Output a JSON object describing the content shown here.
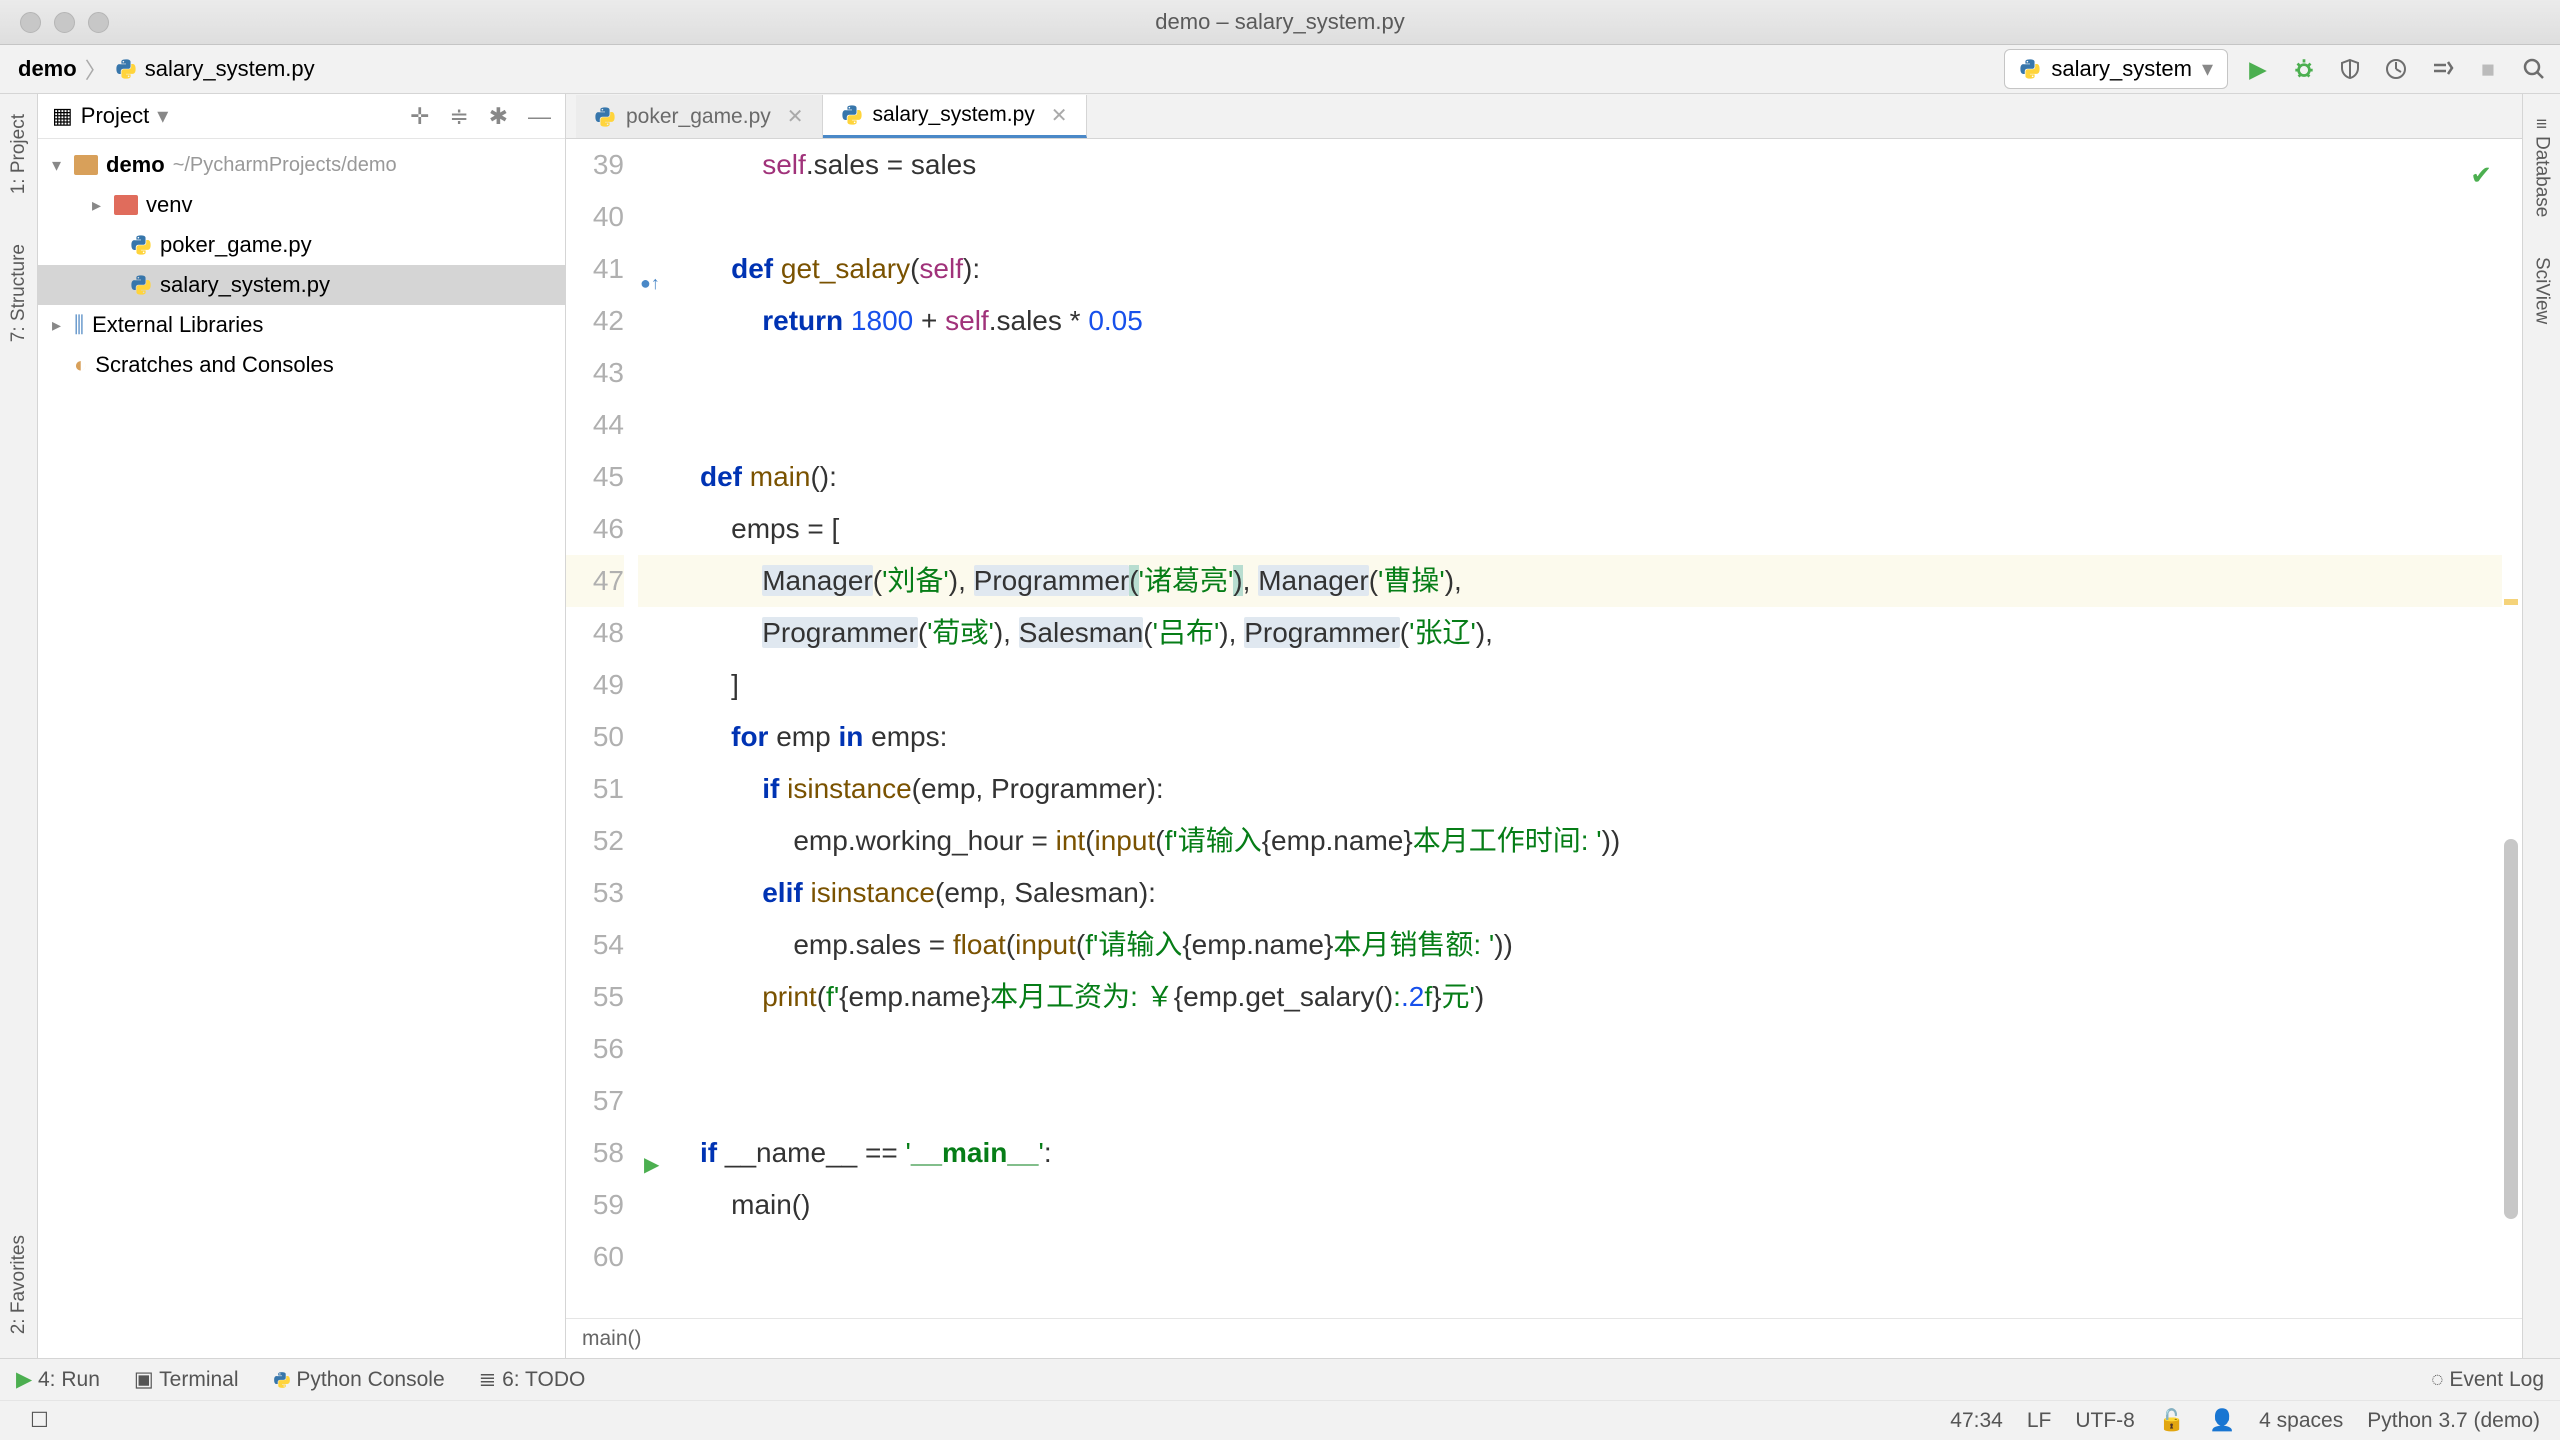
{
  "titlebar": {
    "title": "demo – salary_system.py"
  },
  "breadcrumb": {
    "root": "demo",
    "file": "salary_system.py"
  },
  "run_config": {
    "name": "salary_system"
  },
  "project_panel": {
    "title": "Project",
    "root": "demo",
    "root_path": "~/PycharmProjects/demo",
    "venv": "venv",
    "files": [
      "poker_game.py",
      "salary_system.py"
    ],
    "ext_lib": "External Libraries",
    "scratches": "Scratches and Consoles"
  },
  "leftrail": {
    "project": "1: Project",
    "structure": "7: Structure",
    "favorites": "2: Favorites"
  },
  "rightrail": {
    "database": "Database",
    "sciview": "SciView"
  },
  "tabs": [
    {
      "name": "poker_game.py",
      "active": false
    },
    {
      "name": "salary_system.py",
      "active": true
    }
  ],
  "code_lines": [
    {
      "n": 39,
      "html": "        <span class='self'>self</span>.sales = sales"
    },
    {
      "n": 40,
      "html": ""
    },
    {
      "n": 41,
      "html": "    <span class='kw'>def</span> <span class='func'>get_salary</span>(<span class='self'>self</span>):",
      "override": true
    },
    {
      "n": 42,
      "html": "        <span class='kw'>return</span> <span class='num'>1800</span> + <span class='self'>self</span>.sales * <span class='num'>0.05</span>"
    },
    {
      "n": 43,
      "html": ""
    },
    {
      "n": 44,
      "html": ""
    },
    {
      "n": 45,
      "html": "<span class='kw'>def</span> <span class='func'>main</span>():"
    },
    {
      "n": 46,
      "html": "    emps = ["
    },
    {
      "n": 47,
      "html": "        <span class='highlight'>Manager</span>(<span class='str'>'刘备'</span>), <span class='highlight'>Programmer</span><span class='paren-match'>(</span><span class='str'>'诸葛亮'</span><span class='paren-match'>)</span>, <span class='highlight'>Manager</span>(<span class='str'>'曹操'</span>),",
      "current": true
    },
    {
      "n": 48,
      "html": "        <span class='highlight'>Programmer</span>(<span class='str'>'荀彧'</span>), <span class='highlight'>Salesman</span>(<span class='str'>'吕布'</span>), <span class='highlight'>Programmer</span>(<span class='str'>'张辽'</span>),"
    },
    {
      "n": 49,
      "html": "    ]"
    },
    {
      "n": 50,
      "html": "    <span class='kw'>for</span> emp <span class='kw'>in</span> emps:"
    },
    {
      "n": 51,
      "html": "        <span class='kw'>if</span> <span class='bi'>isinstance</span>(emp, Programmer):"
    },
    {
      "n": 52,
      "html": "            emp.working_hour = <span class='bi'>int</span>(<span class='bi'>input</span>(<span class='green'>f</span><span class='str'>'请输入</span>{emp.name}<span class='str'>本月工作时间: '</span>))"
    },
    {
      "n": 53,
      "html": "        <span class='kw'>elif</span> <span class='bi'>isinstance</span>(emp, Salesman):"
    },
    {
      "n": 54,
      "html": "            emp.sales = <span class='bi'>float</span>(<span class='bi'>input</span>(<span class='green'>f</span><span class='str'>'请输入</span>{emp.name}<span class='str'>本月销售额: '</span>))"
    },
    {
      "n": 55,
      "html": "        <span class='bi'>print</span>(<span class='green'>f</span><span class='str'>'</span>{emp.name}<span class='str'>本月工资为: ￥</span>{emp.get_salary()<span class='str'>:</span><span class='num'>.2</span><span class='str'>f</span>}<span class='str'>元'</span>)"
    },
    {
      "n": 56,
      "html": ""
    },
    {
      "n": 57,
      "html": ""
    },
    {
      "n": 58,
      "html": "<span class='kw'>if</span> __name__ == <span class='str'>'</span><span class='str' style='font-weight:600'>__main__</span><span class='str'>'</span>:",
      "run": true
    },
    {
      "n": 59,
      "html": "    main()"
    },
    {
      "n": 60,
      "html": ""
    }
  ],
  "footer_crumb": "main()",
  "bottombar": {
    "run": "4: Run",
    "terminal": "Terminal",
    "pyconsole": "Python Console",
    "todo": "6: TODO",
    "event_log": "Event Log"
  },
  "statusbar": {
    "pos": "47:34",
    "le": "LF",
    "enc": "UTF-8",
    "indent": "4 spaces",
    "interpreter": "Python 3.7 (demo)"
  }
}
